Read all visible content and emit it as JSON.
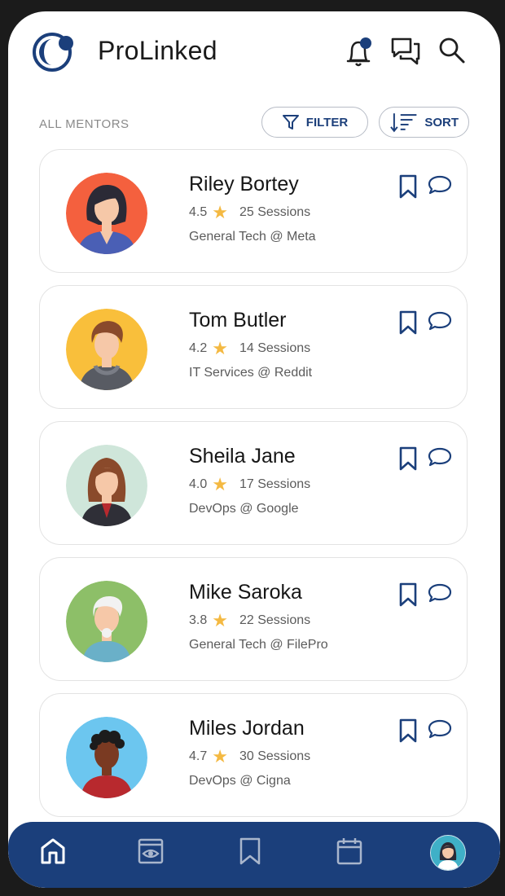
{
  "app": {
    "title": "ProLinked"
  },
  "list": {
    "section_label": "ALL MENTORS",
    "filter_label": "FILTER",
    "sort_label": "SORT"
  },
  "mentors": [
    {
      "name": "Riley Bortey",
      "rating": "4.5",
      "sessions": "25 Sessions",
      "role": "General Tech @ Meta",
      "avatar_bg": "#f4603e"
    },
    {
      "name": "Tom Butler",
      "rating": "4.2",
      "sessions": "14 Sessions",
      "role": "IT Services @ Reddit",
      "avatar_bg": "#f9bf3b"
    },
    {
      "name": "Sheila Jane",
      "rating": "4.0",
      "sessions": "17 Sessions",
      "role": "DevOps @ Google",
      "avatar_bg": "#cfe6da"
    },
    {
      "name": "Mike Saroka",
      "rating": "3.8",
      "sessions": "22 Sessions",
      "role": "General Tech @ FilePro",
      "avatar_bg": "#8dbf68"
    },
    {
      "name": "Miles Jordan",
      "rating": "4.7",
      "sessions": "30 Sessions",
      "role": "DevOps @ Cigna",
      "avatar_bg": "#6cc6ef"
    }
  ],
  "icons": {
    "header": [
      "notification-bell-icon",
      "chat-icon",
      "search-icon"
    ],
    "nav": [
      "home-icon",
      "watch-icon",
      "bookmark-icon",
      "calendar-icon",
      "profile-avatar"
    ]
  },
  "colors": {
    "brand": "#1b3f7b",
    "star": "#f4b942"
  }
}
